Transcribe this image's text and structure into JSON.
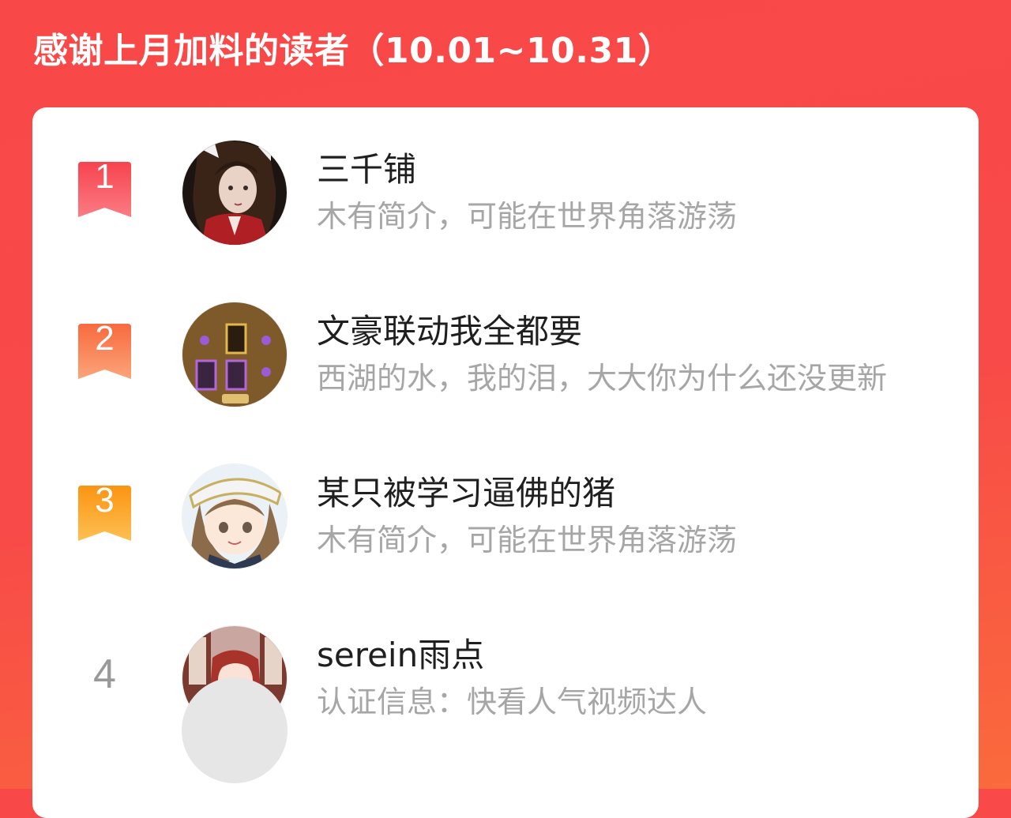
{
  "header": {
    "title": "感谢上月加料的读者（10.01~10.31）"
  },
  "colors": {
    "background": "#f94848",
    "rank1": "#f9545e",
    "rank2": "#fa7a4a",
    "rank3": "#fb9a1e",
    "rank_plain": "#999999"
  },
  "readers": [
    {
      "rank": "1",
      "name": "三千铺",
      "bio": "木有简介，可能在世界角落游荡",
      "avatar": "avatar-dark-haired-doll"
    },
    {
      "rank": "2",
      "name": "文豪联动我全都要",
      "bio": "西湖的水，我的泪，大大你为什么还没更新",
      "avatar": "avatar-game-cards"
    },
    {
      "rank": "3",
      "name": "某只被学习逼佛的猪",
      "bio": "木有简介，可能在世界角落游荡",
      "avatar": "avatar-sailor-anime-girl"
    },
    {
      "rank": "4",
      "name": "serein雨点",
      "bio": "认证信息：快看人气视频达人",
      "avatar": "avatar-red-haired-anime-girl"
    }
  ]
}
